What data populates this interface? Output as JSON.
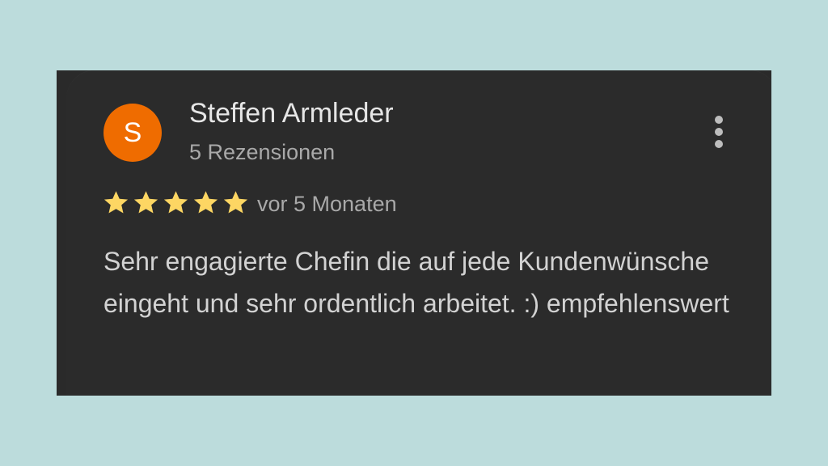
{
  "review": {
    "avatar_letter": "S",
    "avatar_color": "#ef6c00",
    "author_name": "Steffen Armleder",
    "author_reviews": "5 Rezensionen",
    "menu_icon": "more-vert-icon",
    "rating": 5,
    "rating_max": 5,
    "star_color": "#fdd663",
    "date": "vor 5 Monaten",
    "text": "Sehr engagierte Chefin die auf jede Kundenwünsche eingeht und sehr ordentlich arbeitet. :) empfehlenswert"
  }
}
